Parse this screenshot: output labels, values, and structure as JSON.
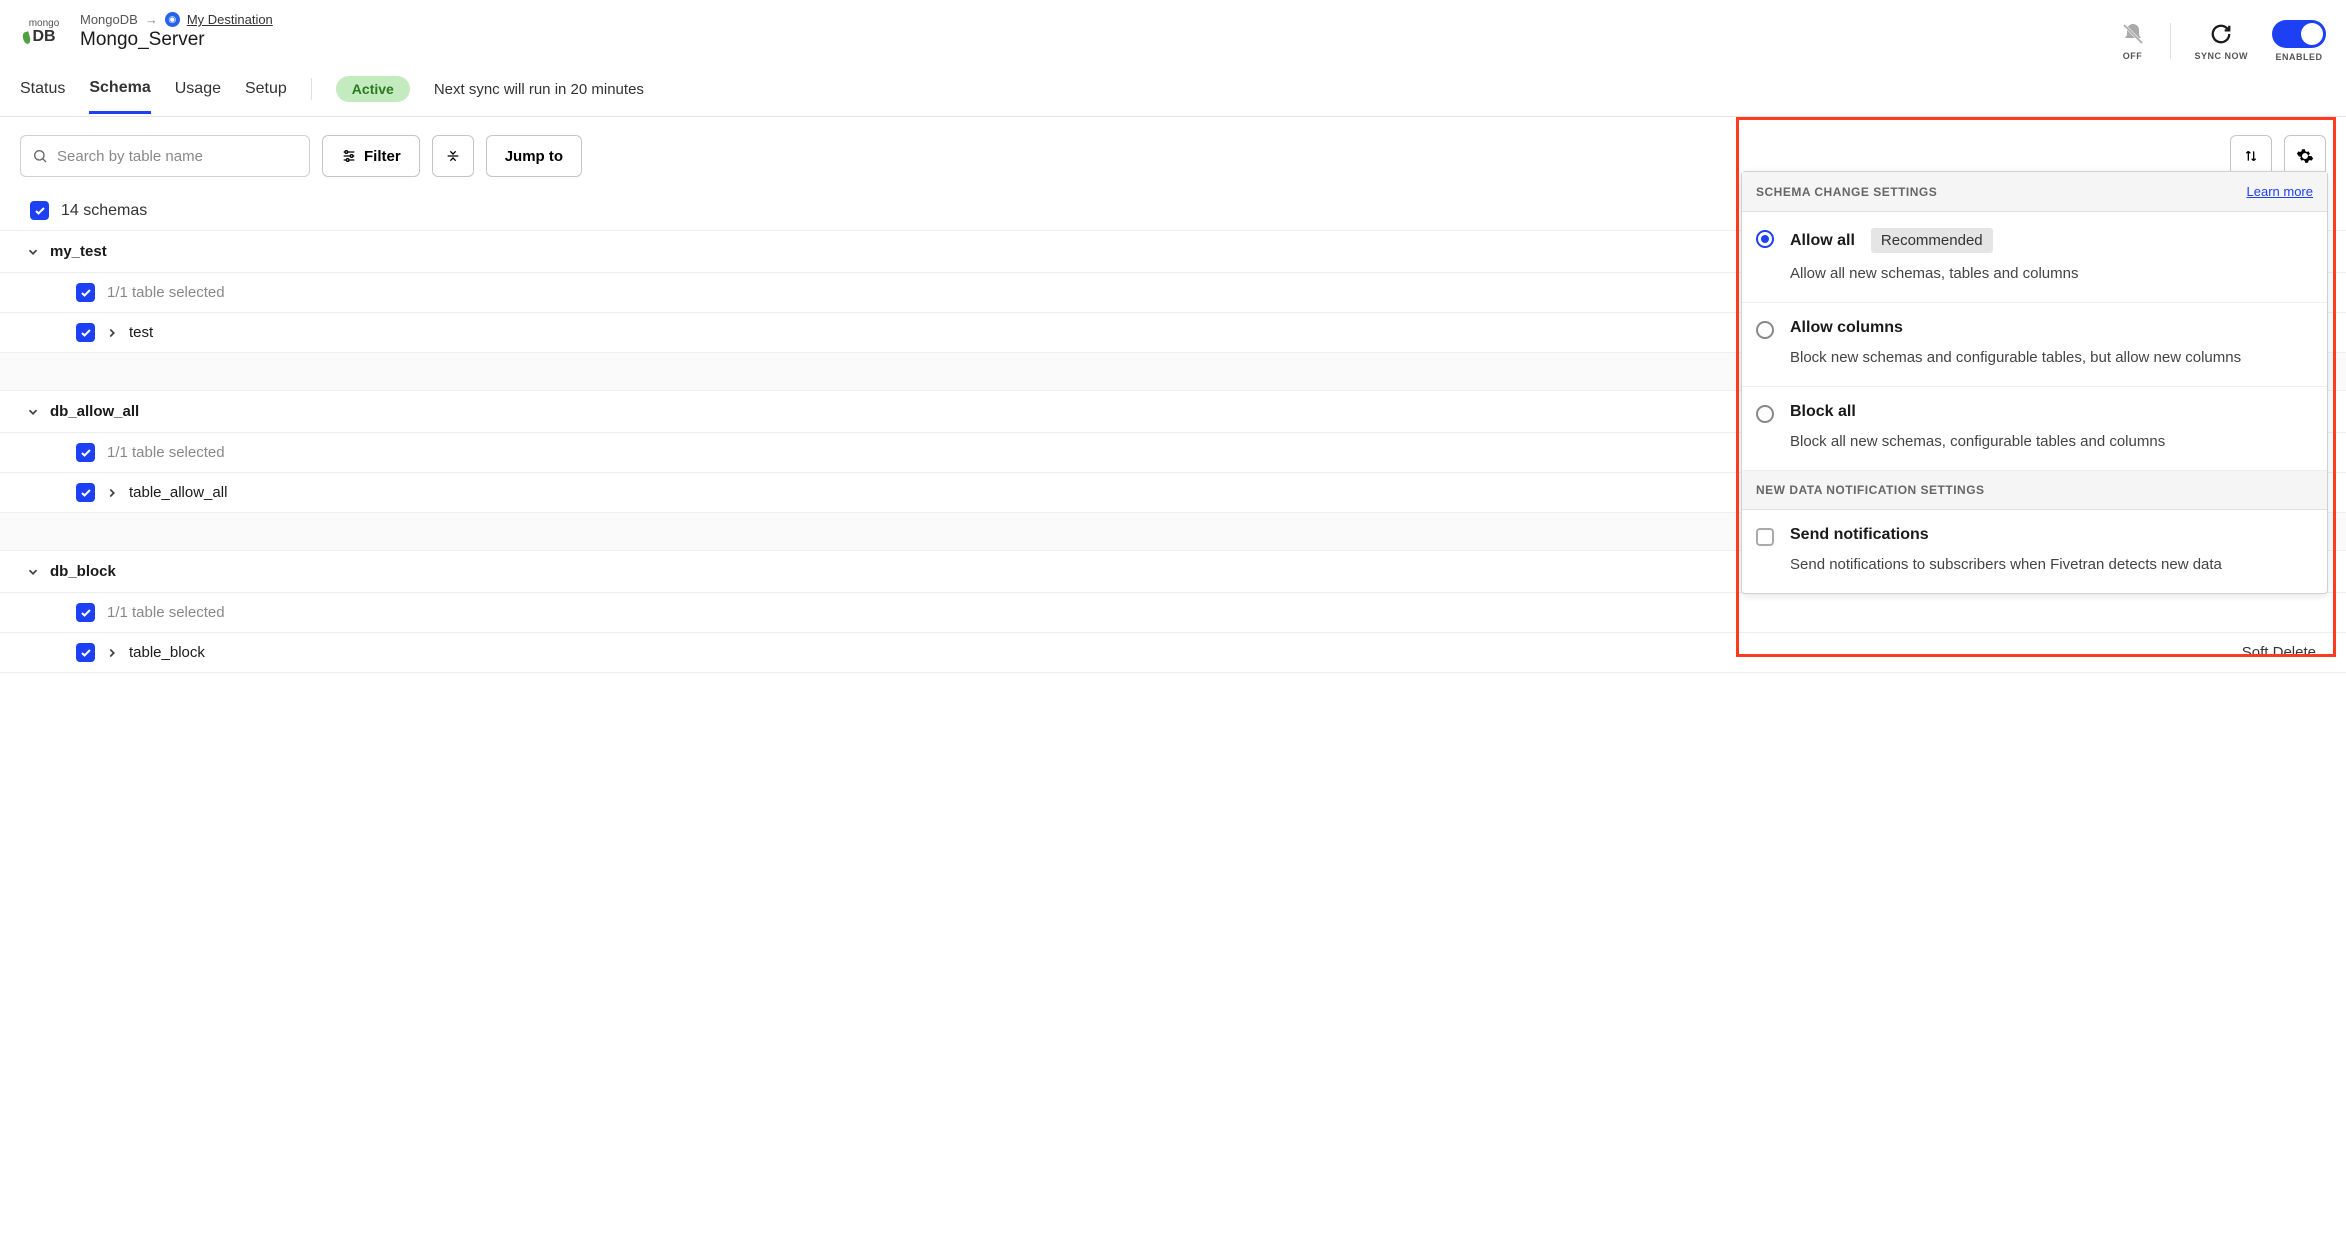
{
  "breadcrumb": {
    "source": "MongoDB",
    "destination": "My Destination"
  },
  "connector_title": "Mongo_Server",
  "tabs": {
    "status": "Status",
    "schema": "Schema",
    "usage": "Usage",
    "setup": "Setup"
  },
  "status_pill": "Active",
  "next_sync_text": "Next sync will run in 20 minutes",
  "header_actions": {
    "off": "OFF",
    "sync_now": "SYNC NOW",
    "enabled": "ENABLED"
  },
  "toolbar": {
    "search_placeholder": "Search by table name",
    "filter": "Filter",
    "jump_to": "Jump to"
  },
  "all_schemas_label": "14 schemas",
  "schemas": [
    {
      "name": "my_test",
      "selected_text": "1/1 table selected",
      "table": "test",
      "soft_delete": ""
    },
    {
      "name": "db_allow_all",
      "selected_text": "1/1 table selected",
      "table": "table_allow_all",
      "soft_delete": ""
    },
    {
      "name": "db_block",
      "selected_text": "1/1 table selected",
      "table": "table_block",
      "soft_delete": "Soft Delete"
    }
  ],
  "panel": {
    "section1_title": "SCHEMA CHANGE SETTINGS",
    "learn_more": "Learn more",
    "options": [
      {
        "title": "Allow all",
        "recommended": "Recommended",
        "desc": "Allow all new schemas, tables and columns"
      },
      {
        "title": "Allow columns",
        "recommended": "",
        "desc": "Block new schemas and configurable tables, but allow new columns"
      },
      {
        "title": "Block all",
        "recommended": "",
        "desc": "Block all new schemas, configurable tables and columns"
      }
    ],
    "section2_title": "NEW DATA NOTIFICATION SETTINGS",
    "notify": {
      "title": "Send notifications",
      "desc": "Send notifications to subscribers when Fivetran detects new data"
    }
  }
}
